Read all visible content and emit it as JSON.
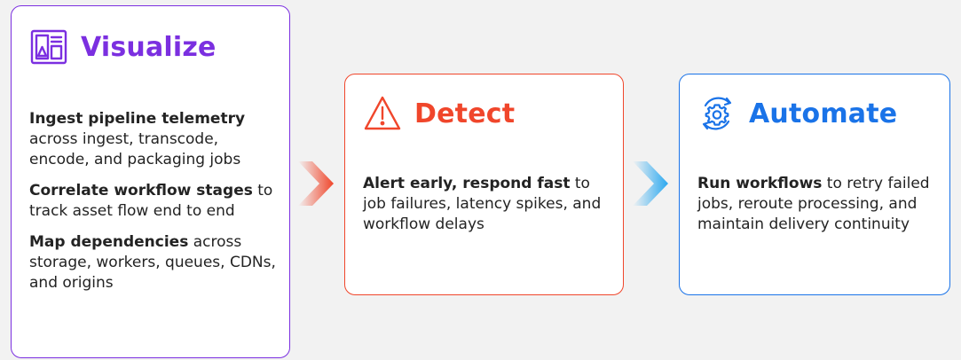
{
  "cards": {
    "visualize": {
      "title": "Visualize",
      "icon": "dashboard-icon",
      "color": "#7b2fe0",
      "items": [
        {
          "bold": "Ingest pipeline telemetry",
          "text": " across ingest, transcode, encode, and packaging jobs"
        },
        {
          "bold": "Correlate workflow stages",
          "text": " to track asset flow end to end"
        },
        {
          "bold": "Map dependencies",
          "text": " across storage, workers, queues, CDNs, and origins"
        }
      ]
    },
    "detect": {
      "title": "Detect",
      "icon": "warning-triangle-icon",
      "color": "#f0462b",
      "items": [
        {
          "bold": "Alert early, respond fast",
          "text": " to job failures, latency spikes, and workflow delays"
        }
      ]
    },
    "automate": {
      "title": "Automate",
      "icon": "gear-cycle-icon",
      "color": "#1a73e8",
      "items": [
        {
          "bold": "Run workflows",
          "text": " to retry failed jobs, reroute processing, and maintain delivery continuity"
        }
      ]
    }
  },
  "connectors": [
    {
      "icon": "chevron-right-icon",
      "color": "#f0462b"
    },
    {
      "icon": "chevron-right-icon",
      "color": "#2aa8f0"
    }
  ]
}
